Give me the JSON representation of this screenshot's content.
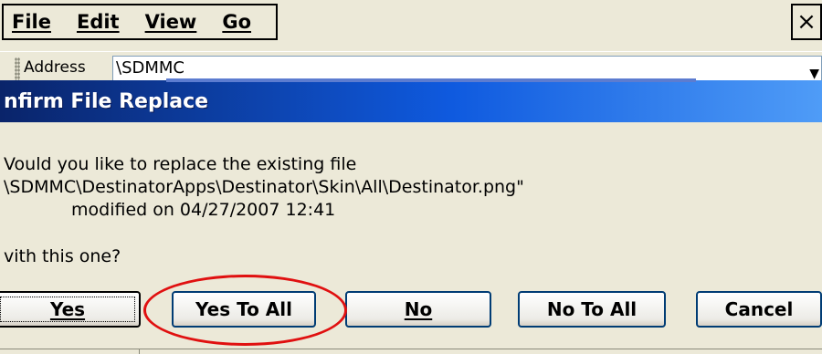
{
  "menu": {
    "items": [
      {
        "label": "File"
      },
      {
        "label": "Edit"
      },
      {
        "label": "View"
      },
      {
        "label": "Go"
      }
    ],
    "close_glyph": "×"
  },
  "address": {
    "label": "Address",
    "value": "\\SDMMC",
    "dropdown_glyph": "▼"
  },
  "dialog": {
    "title": "nfirm File Replace",
    "message_line1": "Vould you like to replace the existing file",
    "message_line2": "\\SDMMC\\DestinatorApps\\Destinator\\Skin\\All\\Destinator.png\"",
    "message_line3": "modified on 04/27/2007 12:41",
    "message_line4": "vith this one?",
    "buttons": {
      "yes": "Yes",
      "yes_to_all": "Yes To All",
      "no": "No",
      "no_to_all": "No To All",
      "cancel": "Cancel"
    }
  },
  "colors": {
    "title_bar": "#0a246a",
    "highlight_ring": "#e01010"
  },
  "icons": {
    "close": "close-icon",
    "dropdown": "chevron-down-icon",
    "grip": "toolbar-grip-icon"
  }
}
